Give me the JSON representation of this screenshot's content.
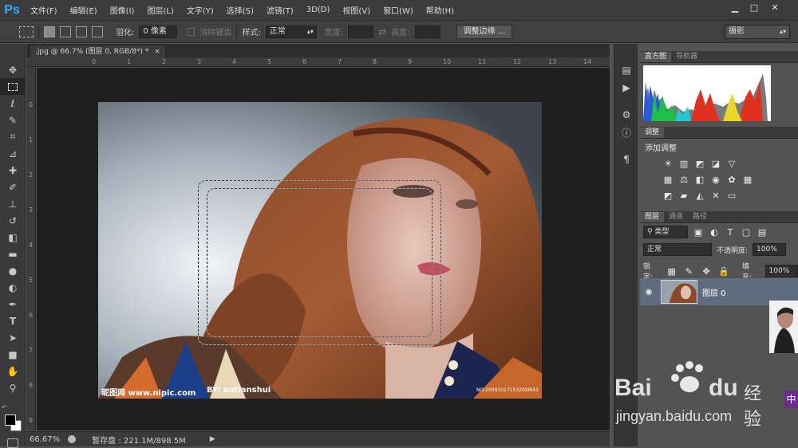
{
  "app": {
    "logo": "Ps"
  },
  "menu": [
    "文件(F)",
    "编辑(E)",
    "图像(I)",
    "图层(L)",
    "文字(Y)",
    "选择(S)",
    "滤镜(T)",
    "3D(D)",
    "视图(V)",
    "窗口(W)",
    "帮助(H)"
  ],
  "options": {
    "feather_label": "羽化:",
    "feather_value": "0 像素",
    "antialias_label": "消除锯齿",
    "style_label": "样式:",
    "style_value": "正常",
    "width_label": "宽度:",
    "height_label": "高度:",
    "refine_button": "调整边缘 ...",
    "workspace_value": "摄影"
  },
  "document": {
    "tab_title": ".jpg @ 66.7% (图层 0, RGB/8*) *",
    "tab_close": "×",
    "ruler_top": [
      "0",
      "1",
      "2",
      "3",
      "4",
      "5",
      "6",
      "7",
      "8",
      "9",
      "10",
      "11",
      "12",
      "13",
      "14"
    ],
    "ruler_left": [
      "0",
      "1",
      "2",
      "3",
      "4",
      "5",
      "6",
      "7",
      "8",
      "9"
    ],
    "photo_caption_left": "昵图网 www.nipic.com",
    "photo_caption_mid": "BY: aotianshui",
    "photo_caption_right": "NO:20091017153209l643"
  },
  "status": {
    "zoom": "66.67%",
    "scratch": "暂存盘 : 221.1M/898.5M"
  },
  "panels": {
    "histogram_tab": "直方图",
    "navigator_tab": "导航器",
    "adjust_tab": "调整",
    "add_adjustment": "添加调整",
    "layers_tab": "图层",
    "channels_tab": "通道",
    "paths_tab": "路径",
    "filter_kind": "类型",
    "blend_mode": "正常",
    "opacity_label": "不透明度:",
    "opacity_value": "100%",
    "lock_label": "锁定:",
    "fill_label": "填充:",
    "fill_value": "100%",
    "layer_name": "图层 0"
  },
  "watermark": {
    "brand": "Bai",
    "brand_tail": "du",
    "jingyan": "经验",
    "url": "jingyan.baidu.com",
    "badge": "中"
  },
  "colors": {
    "accent": "#31a8ff",
    "panel": "#535353",
    "layer_selected": "#5f6c7f"
  }
}
